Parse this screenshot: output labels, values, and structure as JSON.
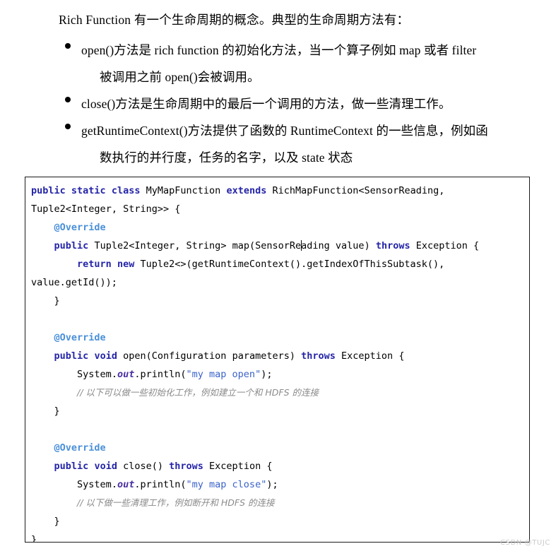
{
  "document": {
    "intro": "Rich Function 有一个生命周期的概念。典型的生命周期方法有：",
    "bullets": [
      {
        "marker": "bullet-dot",
        "lines": [
          "open()方法是 rich function 的初始化方法，当一个算子例如 map 或者 filter",
          "被调用之前 open()会被调用。"
        ]
      },
      {
        "marker": "bullet-dot",
        "lines": [
          "close()方法是生命周期中的最后一个调用的方法，做一些清理工作。"
        ]
      },
      {
        "marker": "bullet-dot",
        "lines": [
          "getRuntimeContext()方法提供了函数的 RuntimeContext 的一些信息，例如函",
          "数执行的并行度，任务的名字，以及 state 状态"
        ]
      }
    ]
  },
  "code": {
    "language": "java",
    "lines": [
      {
        "id": "l1",
        "text": "public static class MyMapFunction extends RichMapFunction<SensorReading,"
      },
      {
        "id": "l2",
        "text": "Tuple2<Integer, String>> {"
      },
      {
        "id": "l3",
        "text": "    @Override"
      },
      {
        "id": "l4",
        "text": "    public Tuple2<Integer, String> map(SensorReading value) throws Exception {"
      },
      {
        "id": "l5",
        "text": "        return new Tuple2<>(getRuntimeContext().getIndexOfThisSubtask(),"
      },
      {
        "id": "l6",
        "text": "value.getId());"
      },
      {
        "id": "l7",
        "text": "    }"
      },
      {
        "id": "l8",
        "text": ""
      },
      {
        "id": "l9",
        "text": "    @Override"
      },
      {
        "id": "l10",
        "text": "    public void open(Configuration parameters) throws Exception {"
      },
      {
        "id": "l11",
        "text": "        System.out.println(\"my map open\");"
      },
      {
        "id": "l12",
        "text": "        // 以下可以做一些初始化工作，例如建立一个和 HDFS 的连接"
      },
      {
        "id": "l13",
        "text": "    }"
      },
      {
        "id": "l14",
        "text": ""
      },
      {
        "id": "l15",
        "text": "    @Override"
      },
      {
        "id": "l16",
        "text": "    public void close() throws Exception {"
      },
      {
        "id": "l17",
        "text": "        System.out.println(\"my map close\");"
      },
      {
        "id": "l18",
        "text": "        // 以下做一些清理工作，例如断开和 HDFS 的连接"
      },
      {
        "id": "l19",
        "text": "    }"
      },
      {
        "id": "l20",
        "text": "}"
      }
    ],
    "tokens": {
      "keywords": [
        "public",
        "static",
        "class",
        "extends",
        "return",
        "new",
        "void",
        "throws"
      ],
      "annotation": "@Override",
      "strings": [
        "\"my map open\"",
        "\"my map close\""
      ],
      "comments": [
        "// 以下可以做一些初始化工作，例如建立一个和 HDFS 的连接",
        "// 以下做一些清理工作，例如断开和 HDFS 的连接"
      ],
      "static_field": "out"
    },
    "colors": {
      "keyword": "#2525a8",
      "annotation": "#4a90d9",
      "string": "#3a62c8",
      "comment": "#8a8a8a",
      "static_field": "#4b2fa0",
      "plain": "#000000",
      "border": "#1a1a1a",
      "background": "#ffffff"
    }
  },
  "watermark": {
    "text": "CSDN @TUJC"
  }
}
